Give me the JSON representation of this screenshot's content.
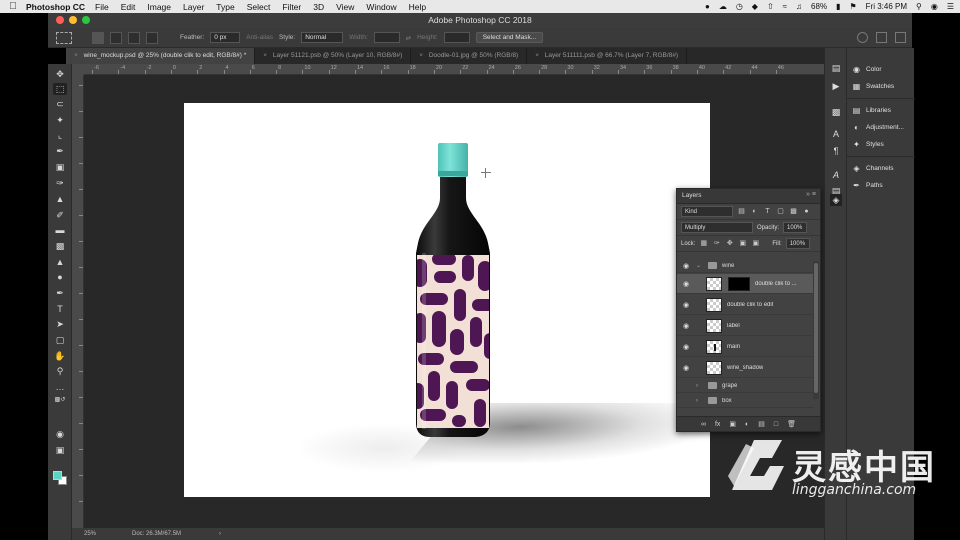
{
  "menubar": {
    "app_name": "Photoshop CC",
    "items": [
      "File",
      "Edit",
      "Image",
      "Layer",
      "Type",
      "Select",
      "Filter",
      "3D",
      "View",
      "Window",
      "Help"
    ],
    "battery": "68%",
    "clock": "Fri 3:46 PM"
  },
  "window": {
    "title": "Adobe Photoshop CC 2018"
  },
  "options": {
    "feather_label": "Feather:",
    "feather_value": "0 px",
    "anti_alias": "Anti-alias",
    "style_label": "Style:",
    "style_value": "Normal",
    "width_label": "Width:",
    "height_label": "Height:",
    "select_mask": "Select and Mask..."
  },
  "tabs": [
    {
      "label": "wine_mockup.psd @ 25% (double clik to edit, RGB/8#) *",
      "close": "×"
    },
    {
      "label": "Layer 51121.psb @ 50% (Layer 10, RGB/8#)",
      "close": "×"
    },
    {
      "label": "Doodle-01.jpg @ 50% (RGB/8)",
      "close": "×"
    },
    {
      "label": "Layer 511111.psb @ 66.7% (Layer 7, RGB/8#)",
      "close": "×"
    }
  ],
  "ruler": {
    "labels": [
      "-6",
      "-4",
      "-2",
      "0",
      "2",
      "4",
      "6",
      "8",
      "10",
      "12",
      "14",
      "16",
      "18",
      "20",
      "22",
      "24",
      "26",
      "28",
      "30",
      "32",
      "34",
      "36",
      "38",
      "40",
      "42",
      "44",
      "46"
    ]
  },
  "status": {
    "zoom": "25%",
    "doc": "Doc: 26.3M/67.5M",
    "arrow": "›"
  },
  "panels": {
    "color": "Color",
    "swatches": "Swatches",
    "libraries": "Libraries",
    "adjustments": "Adjustment...",
    "styles": "Styles",
    "channels": "Channels",
    "paths": "Paths"
  },
  "layers_panel": {
    "title": "Layers",
    "kind": "Kind",
    "blend_mode": "Multiply",
    "opacity_label": "Opacity:",
    "opacity": "100%",
    "lock_label": "Lock:",
    "fill_label": "Fill:",
    "fill": "100%",
    "layers": [
      {
        "name": "wine",
        "type": "group"
      },
      {
        "name": "double clik to ...",
        "type": "smart-mask"
      },
      {
        "name": "double clik to edit",
        "type": "smart"
      },
      {
        "name": "label",
        "type": "layer"
      },
      {
        "name": "main",
        "type": "layer"
      },
      {
        "name": "wine_shadow",
        "type": "layer"
      },
      {
        "name": "grape",
        "type": "group"
      },
      {
        "name": "box",
        "type": "group"
      }
    ]
  },
  "colors": {
    "accent_fg": "#5bd2c4",
    "bottle_cap": "#63d6cb",
    "bottle_glass": "#161616",
    "label_bg": "#f2e0d6",
    "label_pattern": "#4e1753"
  },
  "watermark": {
    "text": "灵感中国",
    "url": "lingganchina.com"
  }
}
